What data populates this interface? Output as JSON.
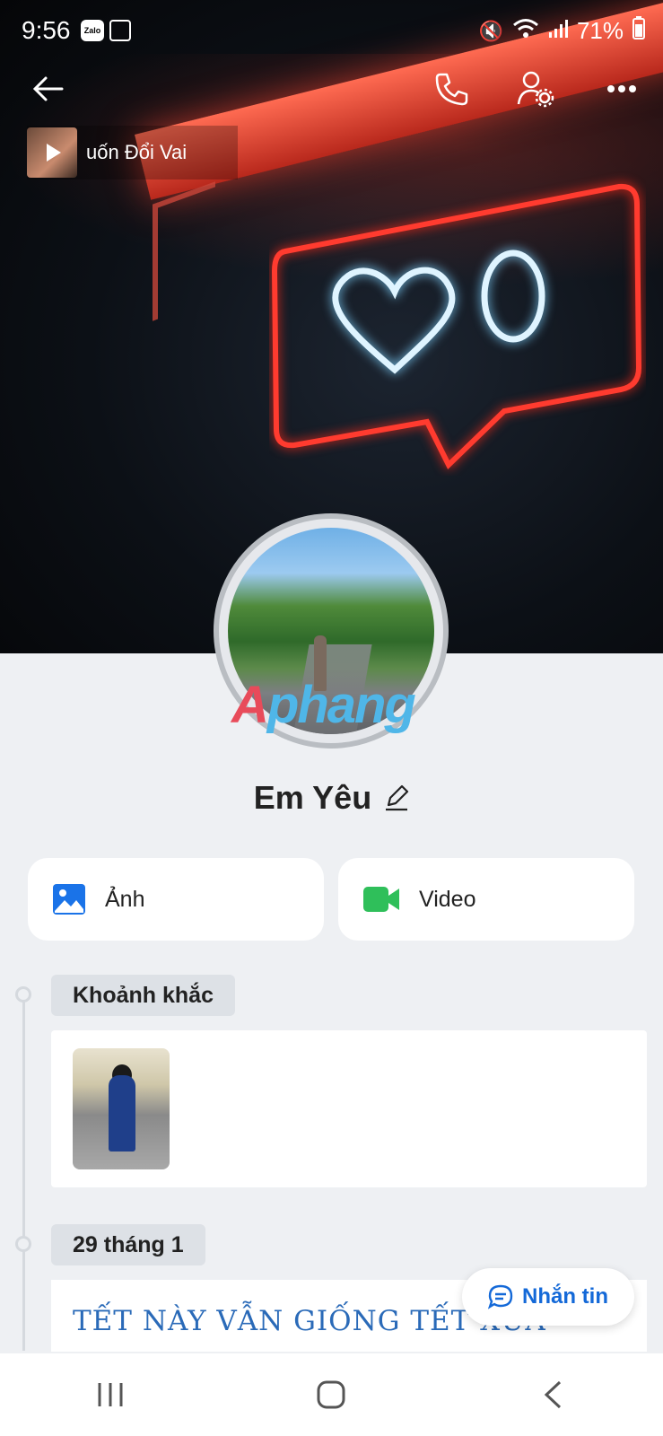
{
  "status_bar": {
    "time": "9:56",
    "zalo_badge": "Zalo",
    "battery": "71%"
  },
  "header": {
    "music_title": "uốn Đổi Vai"
  },
  "profile": {
    "name": "Em Yêu",
    "watermark_a": "A",
    "watermark_b": "phang"
  },
  "media_buttons": {
    "photos_label": "Ảnh",
    "videos_label": "Video"
  },
  "timeline": {
    "moments_label": "Khoảnh khắc",
    "date_label": "29 tháng 1",
    "post_text": "TẾT NÀY VẪN GIỐNG TẾT XƯA"
  },
  "chat_button": {
    "label": "Nhắn tin"
  },
  "colors": {
    "accent": "#1469d8",
    "photo_icon": "#1a73e8",
    "video_icon": "#2fbf5a"
  }
}
